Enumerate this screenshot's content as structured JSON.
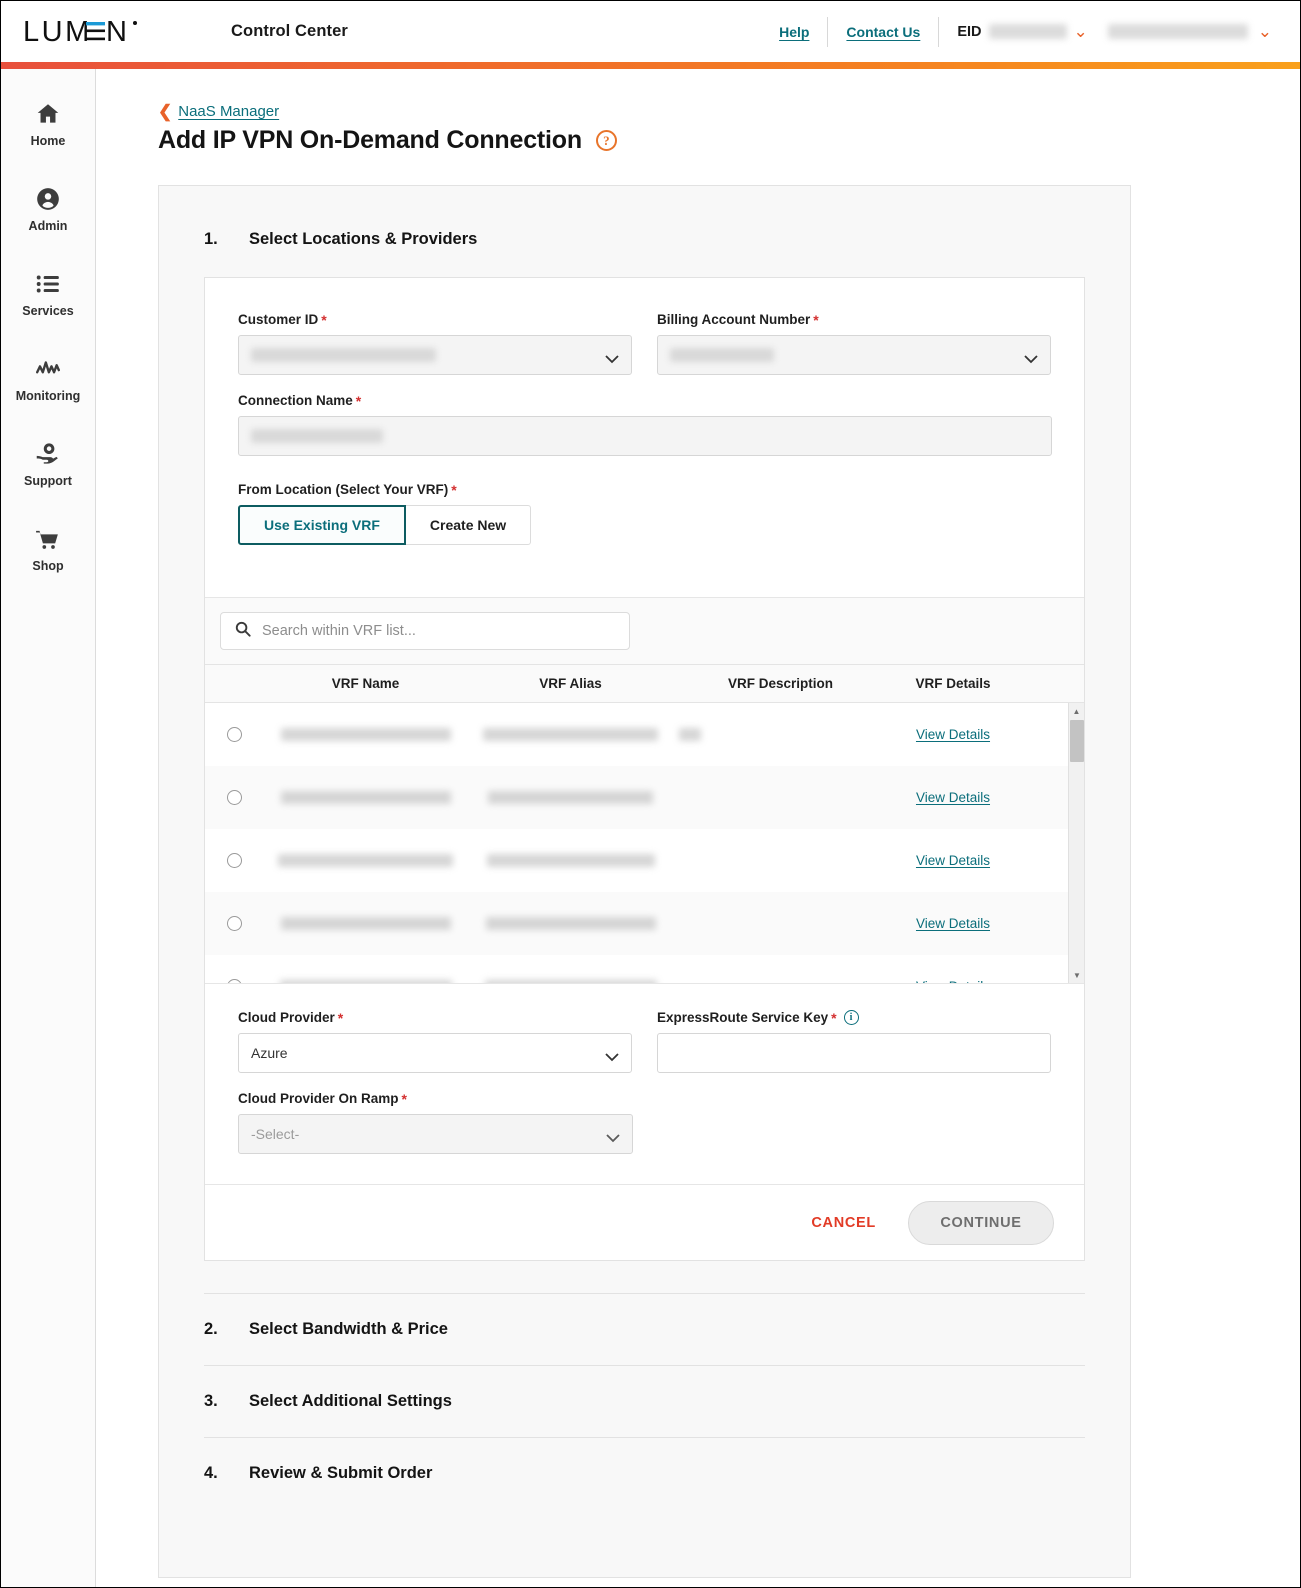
{
  "header": {
    "brand": "LUMEN",
    "app_title": "Control Center",
    "help_label": "Help",
    "contact_label": "Contact Us",
    "eid_label": "EID",
    "eid_value": "",
    "account_value": "",
    "accent_gradient_from": "#e8503c",
    "accent_gradient_to": "#f9a01b",
    "link_color": "#0b6e7b"
  },
  "sidebar": {
    "items": [
      {
        "label": "Home",
        "icon": "home-icon"
      },
      {
        "label": "Admin",
        "icon": "user-circle-icon"
      },
      {
        "label": "Services",
        "icon": "list-icon"
      },
      {
        "label": "Monitoring",
        "icon": "activity-icon"
      },
      {
        "label": "Support",
        "icon": "support-hand-icon"
      },
      {
        "label": "Shop",
        "icon": "cart-icon"
      }
    ]
  },
  "breadcrumb": {
    "back_label": "NaaS Manager"
  },
  "page": {
    "title": "Add IP VPN On-Demand Connection",
    "help_glyph": "?"
  },
  "steps": [
    {
      "num": "1.",
      "name": "Select Locations & Providers"
    },
    {
      "num": "2.",
      "name": "Select Bandwidth & Price"
    },
    {
      "num": "3.",
      "name": "Select Additional Settings"
    },
    {
      "num": "4.",
      "name": "Review & Submit Order"
    }
  ],
  "form": {
    "customer_id": {
      "label": "Customer ID",
      "required": "*",
      "value": "",
      "redacted": true
    },
    "billing_account": {
      "label": "Billing Account Number",
      "required": "*",
      "value": "",
      "redacted": true
    },
    "connection_name": {
      "label": "Connection Name",
      "required": "*",
      "value": "",
      "redacted": true
    },
    "from_location": {
      "label": "From Location (Select Your VRF)",
      "required": "*",
      "options": [
        {
          "label": "Use Existing VRF",
          "selected": true
        },
        {
          "label": "Create New",
          "selected": false
        }
      ]
    },
    "cloud_provider": {
      "label": "Cloud Provider",
      "required": "*",
      "value": "Azure"
    },
    "express_route_key": {
      "label": "ExpressRoute Service Key",
      "required": "*",
      "value": "",
      "has_info": true
    },
    "on_ramp": {
      "label": "Cloud Provider On Ramp",
      "required": "*",
      "value": "-Select-",
      "disabled": true
    }
  },
  "vrf": {
    "search_placeholder": "Search within VRF list...",
    "columns": [
      "VRF Name",
      "VRF Alias",
      "VRF Description",
      "VRF Details"
    ],
    "details_link_label": "View Details",
    "rows": [
      {
        "name": "",
        "alias": "",
        "description": "",
        "redacted": true,
        "name_w": 170,
        "alias_w": 175,
        "desc_w": 22
      },
      {
        "name": "",
        "alias": "",
        "description": "",
        "redacted": true,
        "name_w": 170,
        "alias_w": 165,
        "desc_w": 0
      },
      {
        "name": "",
        "alias": "",
        "description": "",
        "redacted": true,
        "name_w": 175,
        "alias_w": 168,
        "desc_w": 0
      },
      {
        "name": "",
        "alias": "",
        "description": "",
        "redacted": true,
        "name_w": 170,
        "alias_w": 170,
        "desc_w": 0
      },
      {
        "name": "",
        "alias": "",
        "description": "",
        "redacted": true,
        "name_w": 172,
        "alias_w": 172,
        "desc_w": 0
      }
    ]
  },
  "actions": {
    "cancel_label": "CANCEL",
    "continue_label": "CONTINUE",
    "cancel_color": "#e23b26"
  }
}
